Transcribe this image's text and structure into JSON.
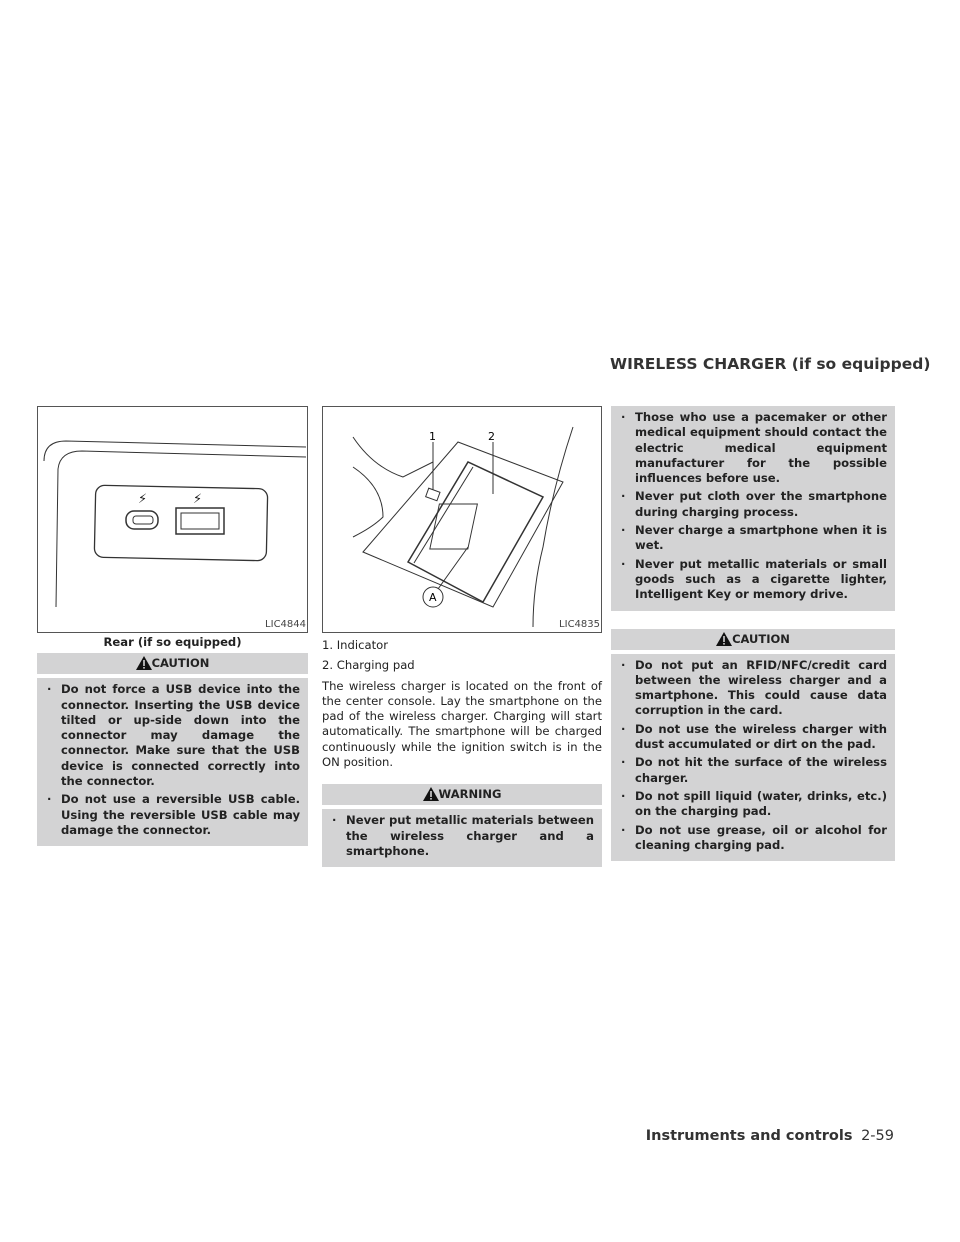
{
  "section_title": "WIRELESS CHARGER (if so equipped)",
  "left": {
    "figure_id": "LIC4844",
    "caption": "Rear (if so equipped)",
    "caution_label": "CAUTION",
    "caution_items": [
      "Do not force a USB device into the connector. Inserting the USB device tilted or up-side down into the connector may damage the connector. Make sure that the USB device is connected correctly into the connector.",
      "Do not use a reversible USB cable. Using the reversible USB cable may damage the connector."
    ]
  },
  "middle": {
    "figure_id": "LIC4835",
    "callouts": {
      "one": "1",
      "two": "2",
      "a": "A"
    },
    "legend": [
      "1. Indicator",
      "2. Charging pad"
    ],
    "paragraph": "The wireless charger is located on the front of the center console. Lay the smartphone on the pad of the wireless charger. Charging will start automatically. The smartphone will be charged continuously while the ignition switch is in the ON position.",
    "warning_label": "WARNING",
    "warning_items": [
      "Never put metallic materials between the wireless charger and a smartphone."
    ]
  },
  "right": {
    "warning_items": [
      "Those who use a pacemaker or other medical equipment should contact the electric medical equipment manufacturer for the possible influences before use.",
      "Never put cloth over the smartphone during charging process.",
      "Never charge a smartphone when it is wet.",
      "Never put metallic materials or small goods such as a cigarette lighter, Intelligent Key or memory drive."
    ],
    "caution_label": "CAUTION",
    "caution_items": [
      "Do not put an RFID/NFC/credit card between the wireless charger and a smartphone. This could cause data corruption in the card.",
      "Do not use the wireless charger with dust accumulated or dirt on the pad.",
      "Do not hit the surface of the wireless charger.",
      "Do not spill liquid (water, drinks, etc.) on the charging pad.",
      "Do not use grease, oil or alcohol for cleaning charging pad."
    ]
  },
  "footer": {
    "chapter": "Instruments and controls",
    "page": "2-59"
  }
}
